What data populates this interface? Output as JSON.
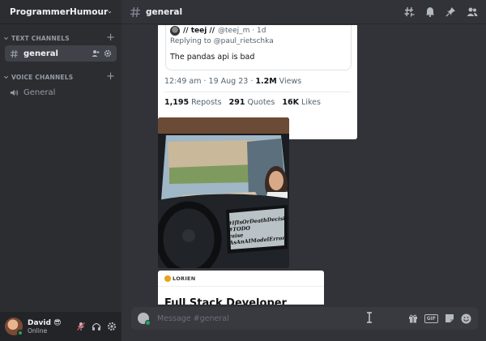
{
  "server": {
    "name": "ProgrammerHumour"
  },
  "sidebar": {
    "text_category": "TEXT CHANNELS",
    "voice_category": "VOICE CHANNELS",
    "text_channels": [
      {
        "name": "general",
        "active": true
      }
    ],
    "voice_channels": [
      {
        "name": "General"
      }
    ]
  },
  "user": {
    "name": "David 😎",
    "status": "Online"
  },
  "header": {
    "channel": "general"
  },
  "tweet": {
    "quoted_author": "// teej //",
    "quoted_handle_time": "@teej_m · 1d",
    "replying_to": "Replying to @paul_rietschka",
    "quoted_text": "The pandas api is bad",
    "timestamp": "12:49 am · 19 Aug 23 · ",
    "views_count": "1.2M",
    "views_label": " Views",
    "reposts_count": "1,195",
    "reposts_label": " Reposts",
    "quotes_count": "291",
    "quotes_label": " Quotes",
    "likes_count": "16K",
    "likes_label": " Likes"
  },
  "meme": {
    "screen_text": "#IfIsOrDeathDecision\n#TODO\nraise AsAnAIModelError"
  },
  "job_card": {
    "logo": "LORIEN",
    "title": "Full Stack Developer"
  },
  "composer": {
    "placeholder": "Message #general",
    "gif_label": "GIF"
  },
  "colors": {
    "background": "#313338",
    "sidebar": "#2b2d31",
    "online": "#23a55a",
    "accent": "#f2f3f5"
  },
  "icons": [
    "chevron-down-icon",
    "hash-icon",
    "speaker-icon",
    "threads-icon",
    "bell-icon",
    "pin-icon",
    "members-icon",
    "mic-muted-icon",
    "headphones-icon",
    "gear-icon",
    "gift-icon",
    "sticker-icon",
    "emoji-icon"
  ]
}
